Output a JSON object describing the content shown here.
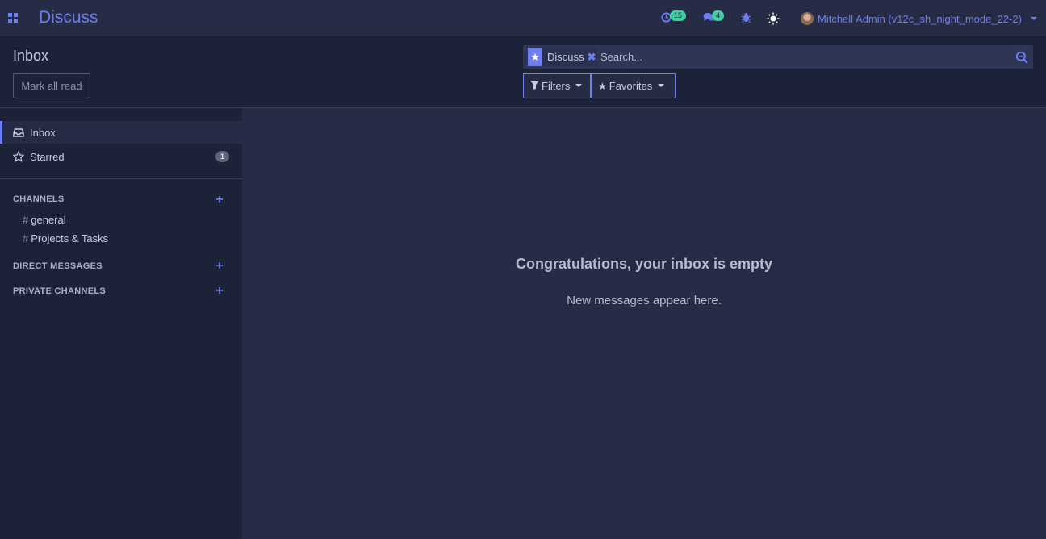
{
  "navbar": {
    "app_name": "Discuss",
    "activity_count": "15",
    "messages_count": "4",
    "user_name": "Mitchell Admin (v12c_sh_night_mode_22-2)",
    "icons": [
      "apps-grid-icon",
      "activity-clock-icon",
      "chat-bubbles-icon",
      "bug-icon",
      "sun-icon"
    ]
  },
  "control_panel": {
    "breadcrumb": "Inbox",
    "mark_all_read": "Mark all read",
    "search": {
      "facet_label": "Discuss",
      "placeholder": "Search..."
    },
    "filters_label": "Filters",
    "favorites_label": "Favorites"
  },
  "sidebar": {
    "mailboxes": [
      {
        "label": "Inbox",
        "active": true
      },
      {
        "label": "Starred",
        "count": "1"
      }
    ],
    "sections": {
      "channels": "CHANNELS",
      "direct_messages": "DIRECT MESSAGES",
      "private_channels": "PRIVATE CHANNELS"
    },
    "channels": [
      {
        "prefix": "#",
        "label": "general"
      },
      {
        "prefix": "#",
        "label": "Projects & Tasks"
      }
    ]
  },
  "main": {
    "empty_title": "Congratulations, your inbox is empty",
    "empty_subtitle": "New messages appear here."
  },
  "colors": {
    "accent": "#6c7ef0",
    "background": "#262c45",
    "panel": "#1c2238",
    "badge_green": "#3fcf9f"
  }
}
